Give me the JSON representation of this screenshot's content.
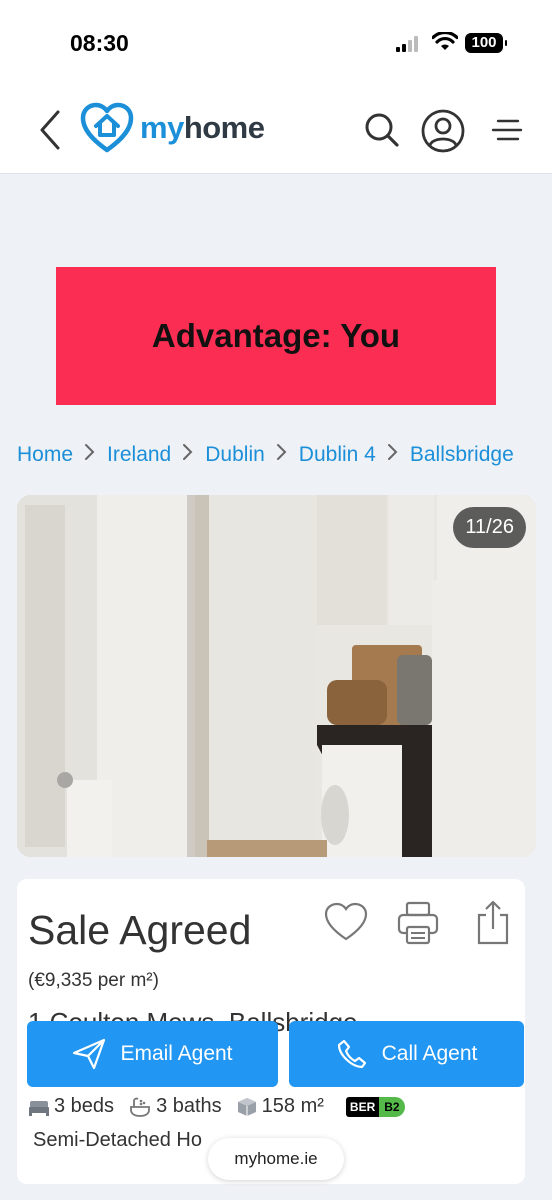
{
  "status_bar": {
    "time": "08:30",
    "battery": "100"
  },
  "header": {
    "logo_my": "my",
    "logo_home": "home",
    "icons": [
      "back-icon",
      "search-icon",
      "user-account-icon",
      "menu-icon"
    ]
  },
  "ad": {
    "text": "Advantage: You",
    "background": "#fc2d52"
  },
  "breadcrumb": [
    "Home",
    "Ireland",
    "Dublin",
    "Dublin 4",
    "Ballsbridge"
  ],
  "gallery": {
    "counter": "11/26"
  },
  "listing": {
    "status": "Sale Agreed",
    "price_per_sqm": "(€9,335 per m²)",
    "address_partial": "1 Coulton Mews, Ballsbridge",
    "beds": "3 beds",
    "baths": "3 baths",
    "area": "158 m²",
    "ber_label": "BER",
    "ber_rating": "B2",
    "property_type": "Semi-Detached Ho"
  },
  "actions": {
    "email": "Email Agent",
    "call": "Call Agent"
  },
  "browser": {
    "url": "myhome.ie"
  },
  "colors": {
    "brand_blue": "#1c8fd9",
    "cta_blue": "#2196f3",
    "ad_red": "#fc2d52"
  }
}
